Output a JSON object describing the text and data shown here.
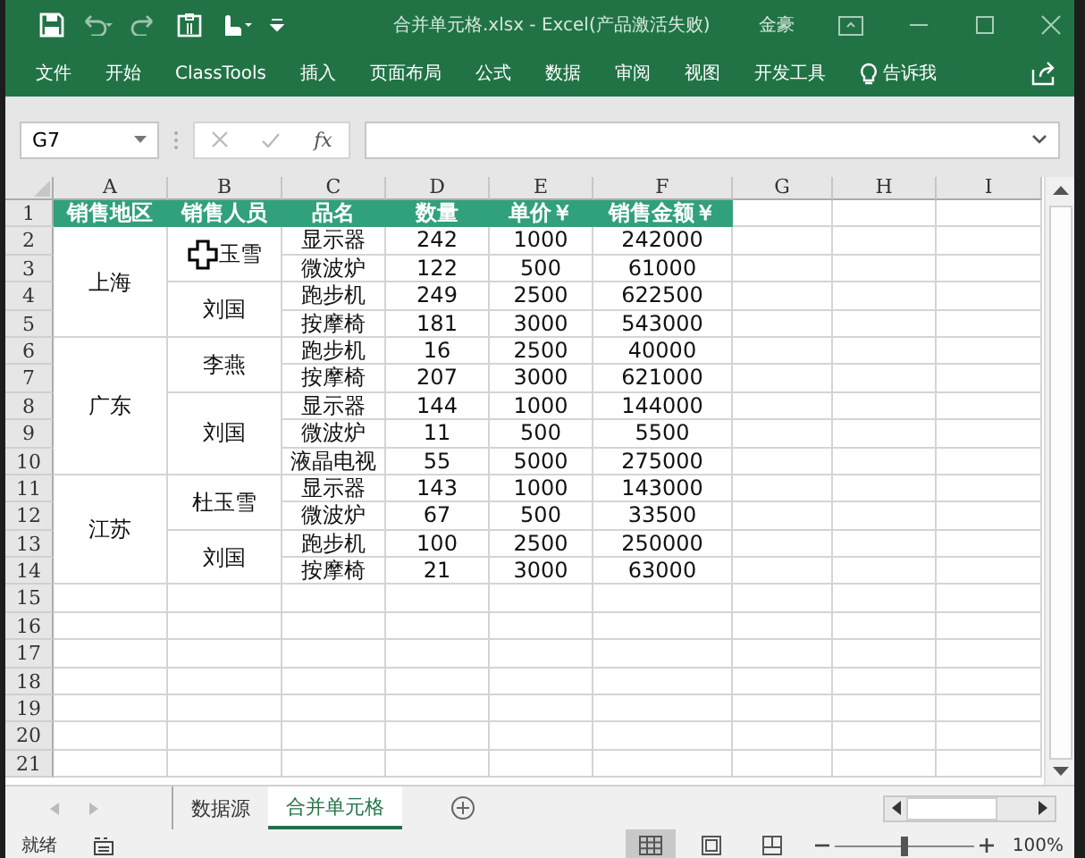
{
  "title_bar": {
    "file_title": "合并单元格.xlsx  -  Excel(产品激活失败)",
    "user": "金豪"
  },
  "ribbon_tabs": [
    {
      "label": "文件",
      "kind": "tab"
    },
    {
      "label": "开始",
      "kind": "tab"
    },
    {
      "label": "ClassTools",
      "kind": "tab"
    },
    {
      "label": "插入",
      "kind": "tab"
    },
    {
      "label": "页面布局",
      "kind": "tab"
    },
    {
      "label": "公式",
      "kind": "tab"
    },
    {
      "label": "数据",
      "kind": "tab"
    },
    {
      "label": "审阅",
      "kind": "tab"
    },
    {
      "label": "视图",
      "kind": "tab"
    },
    {
      "label": "开发工具",
      "kind": "tab"
    },
    {
      "label": "告诉我",
      "kind": "tell"
    }
  ],
  "formula_bar": {
    "name_box": "G7",
    "function_label": "fx"
  },
  "columns": [
    "A",
    "B",
    "C",
    "D",
    "E",
    "F",
    "G",
    "H",
    "I"
  ],
  "row_numbers": [
    "1",
    "2",
    "3",
    "4",
    "5",
    "6",
    "7",
    "8",
    "9",
    "10",
    "11",
    "12",
    "13",
    "14",
    "15",
    "16",
    "17",
    "18",
    "19",
    "20",
    "21"
  ],
  "headers": [
    "销售地区",
    "销售人员",
    "品名",
    "数量",
    "单价￥",
    "销售金额￥"
  ],
  "regions": [
    {
      "name": "上海",
      "persons": [
        {
          "name": "玉雪",
          "pointer": true,
          "items": [
            [
              "显示器",
              "242",
              "1000",
              "242000"
            ],
            [
              "微波炉",
              "122",
              "500",
              "61000"
            ]
          ]
        },
        {
          "name": "刘国",
          "pointer": false,
          "items": [
            [
              "跑步机",
              "249",
              "2500",
              "622500"
            ],
            [
              "按摩椅",
              "181",
              "3000",
              "543000"
            ]
          ]
        }
      ]
    },
    {
      "name": "广东",
      "persons": [
        {
          "name": "李燕",
          "pointer": false,
          "items": [
            [
              "跑步机",
              "16",
              "2500",
              "40000"
            ],
            [
              "按摩椅",
              "207",
              "3000",
              "621000"
            ]
          ]
        },
        {
          "name": "刘国",
          "pointer": false,
          "items": [
            [
              "显示器",
              "144",
              "1000",
              "144000"
            ],
            [
              "微波炉",
              "11",
              "500",
              "5500"
            ],
            [
              "液晶电视",
              "55",
              "5000",
              "275000"
            ]
          ]
        }
      ]
    },
    {
      "name": "江苏",
      "persons": [
        {
          "name": "杜玉雪",
          "pointer": false,
          "items": [
            [
              "显示器",
              "143",
              "1000",
              "143000"
            ],
            [
              "微波炉",
              "67",
              "500",
              "33500"
            ]
          ]
        },
        {
          "name": "刘国",
          "pointer": false,
          "items": [
            [
              "跑步机",
              "100",
              "2500",
              "250000"
            ],
            [
              "按摩椅",
              "21",
              "3000",
              "63000"
            ]
          ]
        }
      ]
    }
  ],
  "sheet_tabs": [
    {
      "label": "数据源",
      "selected": false
    },
    {
      "label": "合并单元格",
      "selected": true
    }
  ],
  "status_bar": {
    "text": "就绪",
    "views": [
      {
        "kind": "normal",
        "selected": true
      },
      {
        "kind": "page_layout",
        "selected": false
      },
      {
        "kind": "page_break",
        "selected": false
      }
    ],
    "zoom": {
      "level": 0.5,
      "reading": "100%"
    }
  }
}
